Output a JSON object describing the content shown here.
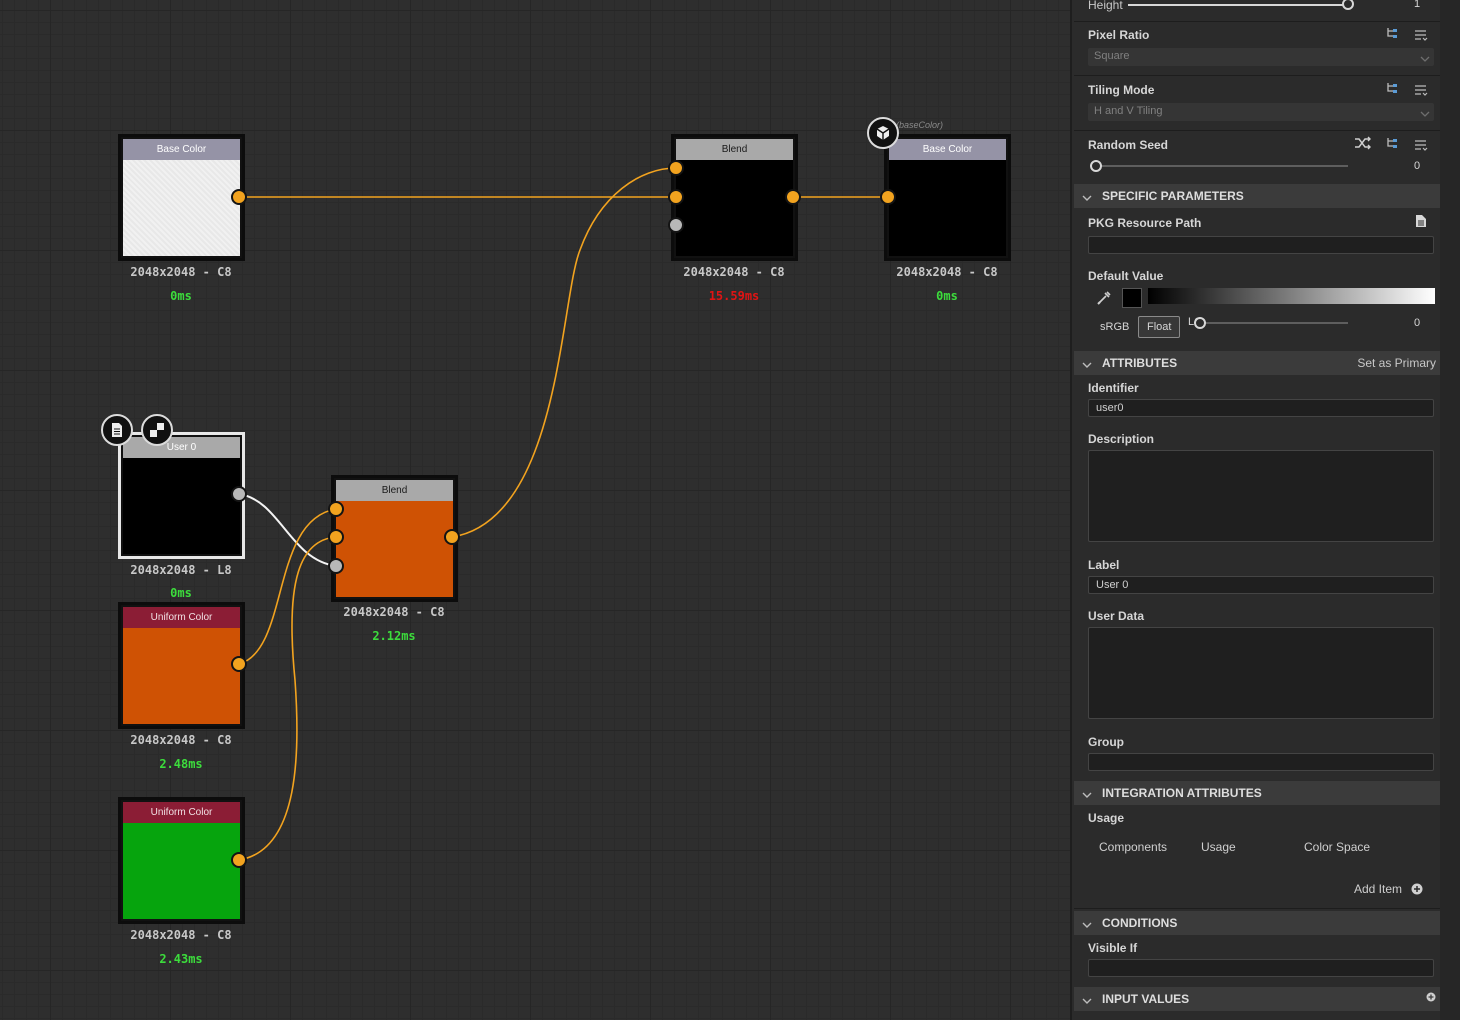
{
  "graph": {
    "nodes": [
      {
        "id": "n1",
        "title": "Base Color",
        "meta": "2048x2048 - C8",
        "time": "0ms"
      },
      {
        "id": "n2",
        "title": "Blend",
        "meta": "2048x2048 - C8",
        "time": "15.59ms"
      },
      {
        "id": "n3",
        "title": "Base Color",
        "tag": "(baseColor)",
        "meta": "2048x2048 - C8",
        "time": "0ms"
      },
      {
        "id": "n4",
        "title": "User 0",
        "meta": "2048x2048 - L8",
        "time": "0ms"
      },
      {
        "id": "n5",
        "title": "Blend",
        "meta": "2048x2048 - C8",
        "time": "2.12ms"
      },
      {
        "id": "n6",
        "title": "Uniform Color",
        "meta": "2048x2048 - C8",
        "time": "2.48ms"
      },
      {
        "id": "n7",
        "title": "Uniform Color",
        "meta": "2048x2048 - C8",
        "time": "2.43ms"
      }
    ]
  },
  "panel": {
    "height": {
      "label": "Height",
      "value": "1"
    },
    "pixel_ratio": {
      "label": "Pixel Ratio",
      "value": "Square"
    },
    "tiling_mode": {
      "label": "Tiling Mode",
      "value": "H and V Tiling"
    },
    "random_seed": {
      "label": "Random Seed",
      "value": "0"
    },
    "specific_parameters": {
      "title": "SPECIFIC PARAMETERS",
      "pkg_resource_path": {
        "label": "PKG Resource Path",
        "value": ""
      },
      "default_value": {
        "label": "Default Value",
        "srgb": "sRGB",
        "float": "Float",
        "lo": "LO",
        "value": "0"
      }
    },
    "attributes": {
      "title": "ATTRIBUTES",
      "set_primary": "Set as Primary",
      "identifier": {
        "label": "Identifier",
        "value": "user0"
      },
      "description": {
        "label": "Description",
        "value": ""
      },
      "label": {
        "label": "Label",
        "value": "User 0"
      },
      "user_data": {
        "label": "User Data",
        "value": ""
      },
      "group": {
        "label": "Group",
        "value": ""
      }
    },
    "integration": {
      "title": "INTEGRATION ATTRIBUTES",
      "usage_label": "Usage",
      "columns": [
        "Components",
        "Usage",
        "Color Space"
      ],
      "add_item": "Add Item"
    },
    "conditions": {
      "title": "CONDITIONS",
      "visible_if": {
        "label": "Visible If",
        "value": ""
      }
    },
    "input_values": {
      "title": "INPUT VALUES"
    }
  },
  "colors": {
    "wire": "#f2a31f",
    "orange": "#cf5204",
    "green": "#06a40d",
    "accent": "#f2a31f"
  }
}
